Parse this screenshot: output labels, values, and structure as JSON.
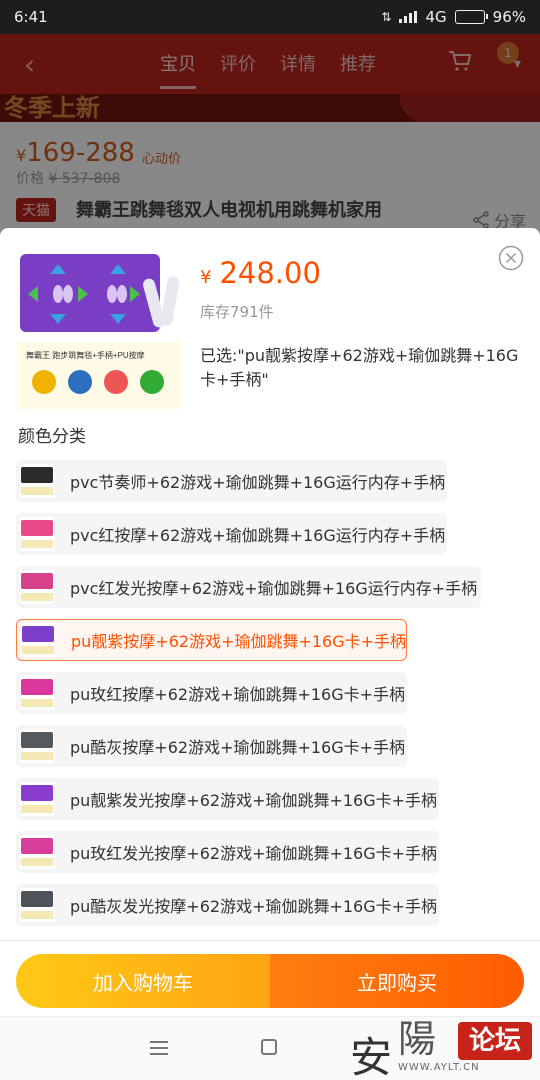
{
  "status_bar": {
    "time": "6:41",
    "network": "4G",
    "battery_percent": "96%",
    "battery_level": 0.96
  },
  "background_page": {
    "nav_tabs": [
      "宝贝",
      "评价",
      "详情",
      "推荐"
    ],
    "cart_badge": "1",
    "banner_text": "冬季上新",
    "price_range": "169-288",
    "currency": "¥",
    "heart_price_label": "心动价",
    "old_price_label": "价格",
    "old_price": "¥ 537-808",
    "store_badge": "天猫",
    "title": "舞霸王跳舞毯双人电视机用跳舞机家用",
    "share_label": "分享"
  },
  "sku_sheet": {
    "currency": "¥",
    "price": "248.00",
    "stock": "库存791件",
    "selected_text": "已选:\"pu靓紫按摩+62游戏+瑜伽跳舞+16G卡+手柄\"",
    "product_image_caption": "舞霸王 跑步跳舞毯+手柄+PU按摩",
    "section_title": "颜色分类",
    "options": [
      {
        "label": "pvc节奏师+62游戏+瑜伽跳舞+16G运行内存+手柄",
        "color": "#2b2b2b",
        "selected": false
      },
      {
        "label": "pvc红按摩+62游戏+瑜伽跳舞+16G运行内存+手柄",
        "color": "#e84a8a",
        "selected": false
      },
      {
        "label": "pvc红发光按摩+62游戏+瑜伽跳舞+16G运行内存+手柄",
        "color": "#d6418a",
        "selected": false
      },
      {
        "label": "pu靓紫按摩+62游戏+瑜伽跳舞+16G卡+手柄",
        "color": "#7b3fc8",
        "selected": true
      },
      {
        "label": "pu玫红按摩+62游戏+瑜伽跳舞+16G卡+手柄",
        "color": "#d9379b",
        "selected": false
      },
      {
        "label": "pu酷灰按摩+62游戏+瑜伽跳舞+16G卡+手柄",
        "color": "#555a5e",
        "selected": false
      },
      {
        "label": "pu靓紫发光按摩+62游戏+瑜伽跳舞+16G卡+手柄",
        "color": "#8a3dcc",
        "selected": false
      },
      {
        "label": "pu玫红发光按摩+62游戏+瑜伽跳舞+16G卡+手柄",
        "color": "#d73d9a",
        "selected": false
      },
      {
        "label": "pu酷灰发光按摩+62游戏+瑜伽跳舞+16G卡+手柄",
        "color": "#4d5358",
        "selected": false
      }
    ],
    "add_to_cart": "加入购物车",
    "buy_now": "立即购买"
  },
  "watermark": {
    "char1": "安",
    "char2": "陽",
    "badge": "论坛",
    "url": "WWW.AYLT.CN"
  },
  "colors": {
    "accent": "#ff5000",
    "nav_red": "#b8241b",
    "cart_yellow": "#ffb412",
    "buy_orange": "#ff6a08"
  }
}
